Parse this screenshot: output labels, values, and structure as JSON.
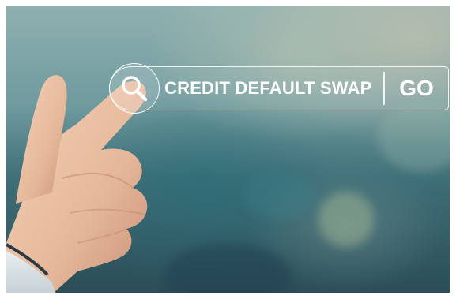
{
  "search": {
    "query": "CREDIT DEFAULT SWAP",
    "go_label": "GO",
    "icon": "search-icon"
  },
  "colors": {
    "bar_outline": "#ffffff",
    "text": "#ffffff"
  }
}
